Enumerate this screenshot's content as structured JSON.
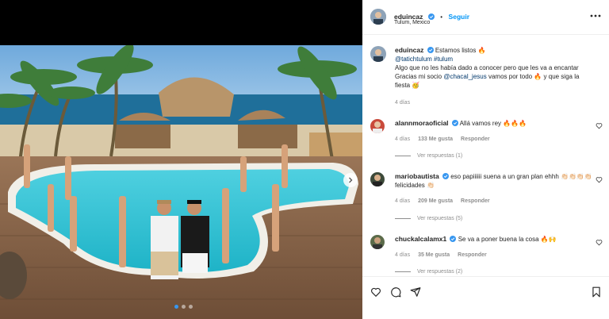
{
  "post": {
    "username": "eduincaz",
    "follow_label": "Seguir",
    "separator": "•",
    "location": "Tulum, Mexico",
    "caption": {
      "username": "eduincaz",
      "text_1": "Estamos listos 🔥",
      "mention_1": "@tatichtulum",
      "hashtag_1": "#tulum",
      "text_2": "Algo que no les había dado a conocer pero que les va a encantar",
      "text_3": "Gracias mi socio",
      "mention_2": "@chacal_jesus",
      "text_4": "vamos por todo 🔥 y que siga la",
      "text_5": "fiesta 🥳",
      "time": "4 días"
    }
  },
  "comments": [
    {
      "username": "alannmoraoficial",
      "text": "Allá vamos rey 🔥🔥🔥",
      "time": "4 días",
      "likes": "133 Me gusta",
      "reply_label": "Responder",
      "replies_label": "Ver respuestas (1)"
    },
    {
      "username": "mariobautista",
      "text_1": "eso papiiiiii suena a un gran plan ehhh 👏🏻👏🏻👏🏻👏🏻",
      "text_2": "felicidades 👏🏻",
      "time": "4 días",
      "likes": "209 Me gusta",
      "reply_label": "Responder",
      "replies_label": "Ver respuestas (5)"
    },
    {
      "username": "chuckalcalamx1",
      "text": "Se va a poner buena la cosa 🔥🙌",
      "time": "4 días",
      "likes": "35 Me gusta",
      "reply_label": "Responder",
      "replies_label": "Ver respuestas (2)"
    }
  ],
  "icons": {
    "like": "heart-icon",
    "comment": "comment-icon",
    "share": "share-icon",
    "save": "bookmark-icon",
    "more": "more-options-icon",
    "verified": "verified-badge-icon",
    "next": "chevron-right-icon"
  },
  "colors": {
    "accent": "#0095f6",
    "verified": "#3897f0",
    "muted": "#8e8e8e",
    "text": "#262626"
  },
  "carousel": {
    "total": 3,
    "active": 1
  }
}
